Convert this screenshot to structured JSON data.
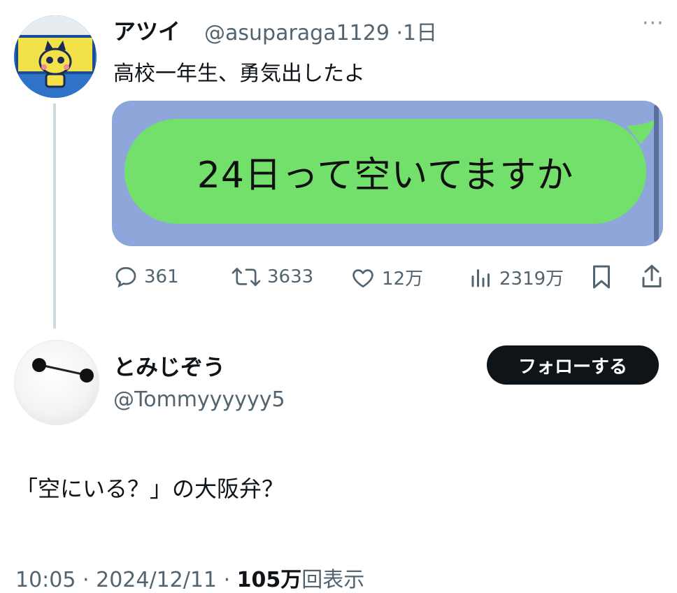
{
  "tweet": {
    "author_name": "アツイ",
    "author_handle": "@asuparaga1129",
    "time_sep": "·",
    "time": "1日",
    "more_label": "···",
    "text": "高校一年生、勇気出したよ",
    "chat_bubble_text": "24日って空いてますか",
    "stats": {
      "replies": "361",
      "retweets": "3633",
      "likes": "12万",
      "views": "2319万"
    }
  },
  "reply": {
    "author_name": "とみじぞう",
    "author_handle": "@Tommyyyyyy5",
    "follow_label": "フォローする",
    "text": "「空にいる？」の大阪弁？",
    "time": "10:05",
    "sep": "·",
    "date": "2024/12/11",
    "views_count": "105万",
    "views_label": "回表示"
  },
  "colors": {
    "line_background": "#8ea6da",
    "bubble_green": "#74e06c",
    "accent_dark": "#0f1419",
    "muted_text": "#536471"
  }
}
